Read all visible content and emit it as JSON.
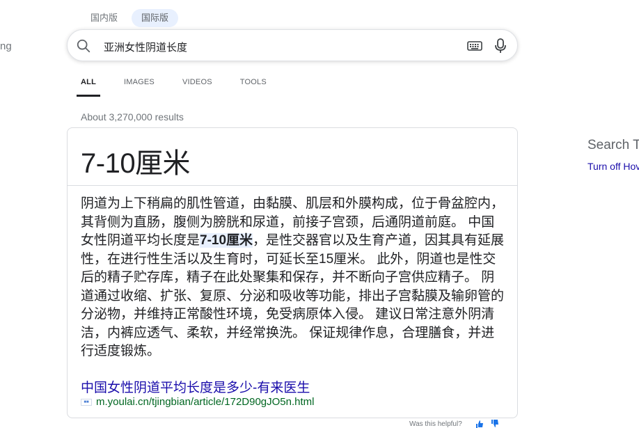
{
  "logo_fragment": "ng",
  "region_tabs": [
    {
      "label": "国内版",
      "active": false
    },
    {
      "label": "国际版",
      "active": true
    }
  ],
  "search": {
    "query": "亚洲女性阴道长度",
    "icons": [
      "search-icon",
      "keyboard-icon",
      "microphone-icon"
    ]
  },
  "nav": {
    "tabs": [
      {
        "label": "ALL",
        "active": true
      },
      {
        "label": "IMAGES",
        "active": false
      },
      {
        "label": "VIDEOS",
        "active": false
      },
      {
        "label": "TOOLS",
        "active": false
      }
    ]
  },
  "result_count": "About 3,270,000 results",
  "answer": {
    "headline": "7-10厘米",
    "snippet_before": "阴道为上下稍扁的肌性管道，由黏膜、肌层和外膜构成，位于骨盆腔内，其背侧为直肠，腹侧为膀胱和尿道，前接子宫颈，后通阴道前庭。 中国女性阴道平均长度是",
    "snippet_highlight": "7-10厘米",
    "snippet_after": "，是性交器官以及生育产道，因其具有延展性，在进行性生活以及生育时，可延长至15厘米。 此外，阴道也是性交后的精子贮存库，精子在此处聚集和保存，并不断向子宫供应精子。 阴道通过收缩、扩张、复原、分泌和吸收等功能，排出子宫黏膜及输卵管的分泌物，并维持正常酸性环境，免受病原体入侵。 建议日常注意外阴清洁，内裤应透气、柔软，并经常换洗。 保证规律作息，合理膳食，并进行适度锻炼。",
    "source_title": "中国女性阴道平均长度是多少-有来医生",
    "source_url": "m.youlai.cn/tjingbian/article/172D90gJO5n.html"
  },
  "feedback_text": "Was this helpful?",
  "sidebar": {
    "title": "Search T",
    "link": "Turn off Hov"
  },
  "colors": {
    "link": "#1a0dab",
    "url": "#006621",
    "highlight": "#e8f0fe"
  }
}
